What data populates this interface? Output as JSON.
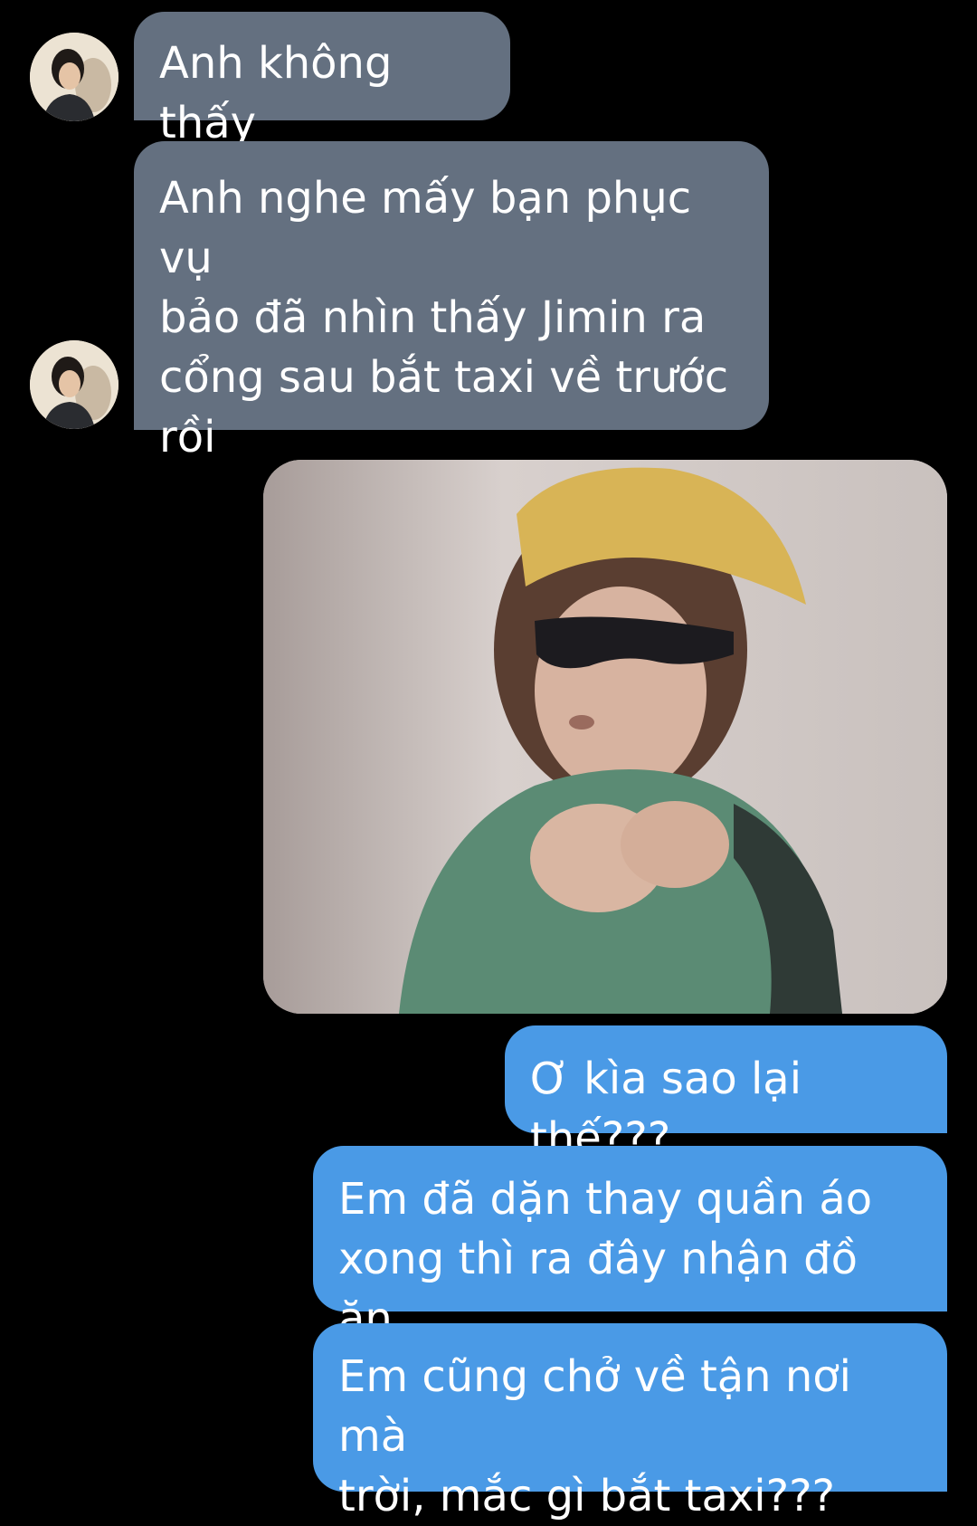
{
  "messages": [
    {
      "sender": "other",
      "text": "Anh không thấy"
    },
    {
      "sender": "other",
      "text": "Anh nghe mấy bạn phục vụ\nbảo đã nhìn thấy Jimin ra\ncổng sau bắt taxi về trước\nrồi"
    },
    {
      "sender": "me",
      "type": "image",
      "image_description": "child-sunglasses-meme"
    },
    {
      "sender": "me",
      "text": "Ơ kìa sao lại thế???"
    },
    {
      "sender": "me",
      "text": "Em đã dặn thay quần áo\nxong thì ra đây nhận đồ ăn"
    },
    {
      "sender": "me",
      "text": "Em cũng chở về tận nơi mà\ntrời, mắc gì bắt taxi???"
    }
  ],
  "colors": {
    "background": "#000000",
    "incoming_bubble": "#647080",
    "outgoing_bubble": "#4a9ae6",
    "text": "#ffffff"
  },
  "icons": {
    "avatar": "contact-avatar-photo"
  }
}
